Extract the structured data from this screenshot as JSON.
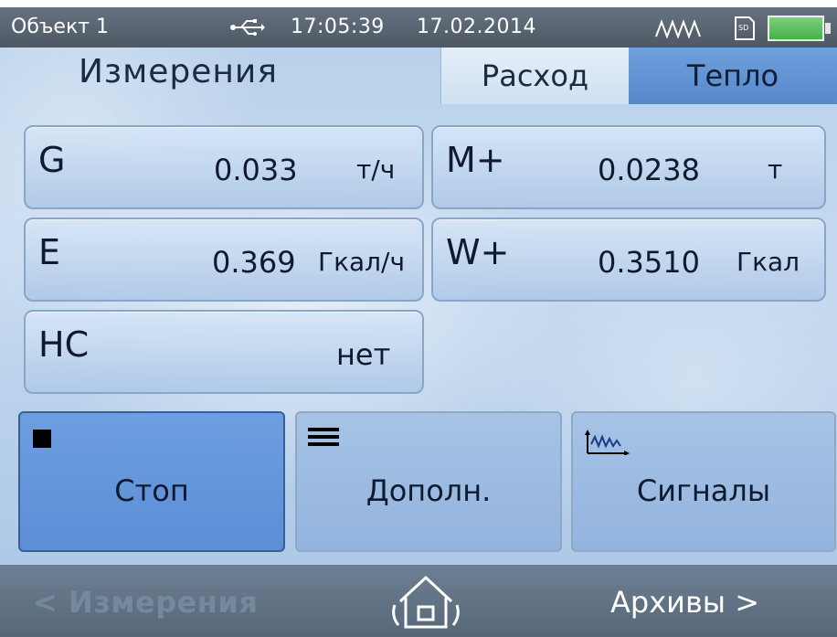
{
  "status_bar": {
    "object_name": "Объект 1",
    "time": "17:05:39",
    "date": "17.02.2014",
    "icons": [
      "usb-icon",
      "signal-wave-icon",
      "sd-card-icon",
      "battery-icon"
    ]
  },
  "header": {
    "title": "Измерения",
    "tabs": [
      {
        "label": "Расход",
        "active": false
      },
      {
        "label": "Тепло",
        "active": true
      }
    ]
  },
  "measurements": {
    "G": {
      "label": "G",
      "value": "0.033",
      "unit": "т/ч"
    },
    "M_plus": {
      "label": "M+",
      "value": "0.0238",
      "unit": "т"
    },
    "E": {
      "label": "E",
      "value": "0.369",
      "unit": "Гкал/ч"
    },
    "W_plus": {
      "label": "W+",
      "value": "0.3510",
      "unit": "Гкал"
    },
    "HC": {
      "label": "НС",
      "value": "нет"
    }
  },
  "buttons": {
    "stop": {
      "label": "Стоп",
      "icon": "stop-square-icon"
    },
    "more": {
      "label": "Дополн.",
      "icon": "menu-lines-icon"
    },
    "signals": {
      "label": "Сигналы",
      "icon": "signal-graph-icon"
    }
  },
  "bottom_nav": {
    "prev_label": "< Измерения",
    "home_icon": "home-icon",
    "next_label": "Архивы >"
  },
  "colors": {
    "active_tab": "#5688cc",
    "stop_button": "#5b8ed6",
    "status_bar": "#566270",
    "battery": "#48b048"
  }
}
